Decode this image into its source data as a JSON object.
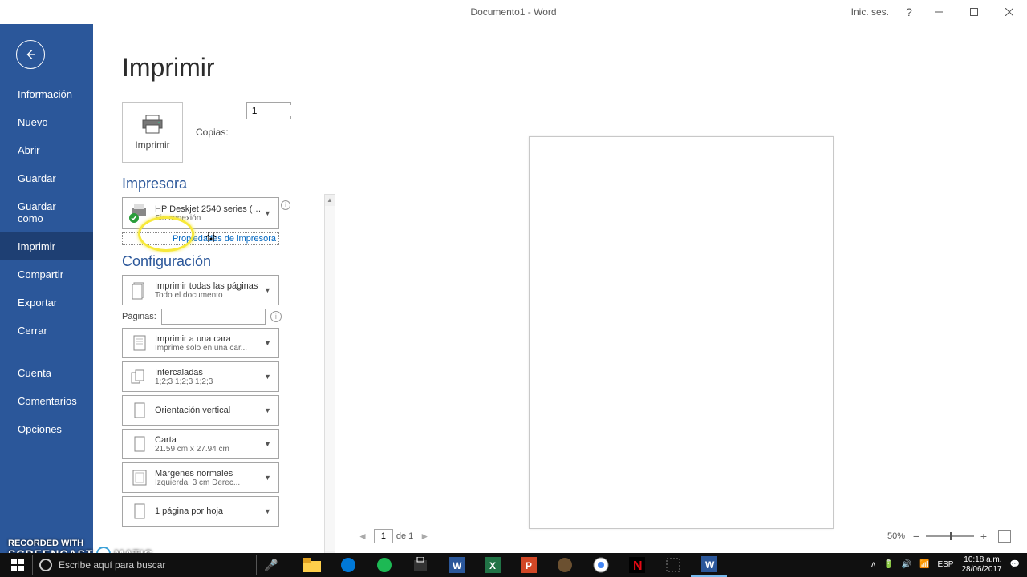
{
  "titlebar": {
    "document": "Documento1 - Word",
    "signin": "Inic. ses."
  },
  "sidebar": {
    "items": [
      "Información",
      "Nuevo",
      "Abrir",
      "Guardar",
      "Guardar como",
      "Imprimir",
      "Compartir",
      "Exportar",
      "Cerrar"
    ],
    "bottom": [
      "Cuenta",
      "Comentarios",
      "Opciones"
    ],
    "selected": "Imprimir"
  },
  "page": {
    "title": "Imprimir",
    "print_btn": "Imprimir",
    "copies_label": "Copias:",
    "copies_value": "1"
  },
  "printer": {
    "heading": "Impresora",
    "name": "HP Deskjet 2540 series (R...",
    "status": "Sin conexión",
    "properties": "Propiedades de impresora"
  },
  "config": {
    "heading": "Configuración",
    "pages_label": "Páginas:",
    "print_what": {
      "l1": "Imprimir todas las páginas",
      "l2": "Todo el documento"
    },
    "sides": {
      "l1": "Imprimir a una cara",
      "l2": "Imprime solo en una car..."
    },
    "collate": {
      "l1": "Intercaladas",
      "l2": "1;2;3    1;2;3    1;2;3"
    },
    "orient": {
      "l1": "Orientación vertical",
      "l2": ""
    },
    "paper": {
      "l1": "Carta",
      "l2": "21.59 cm x 27.94 cm"
    },
    "margins": {
      "l1": "Márgenes normales",
      "l2": "Izquierda:  3 cm    Derec..."
    },
    "ppsheet": {
      "l1": "1 página por hoja",
      "l2": ""
    }
  },
  "preview": {
    "page_current": "1",
    "page_of": "de 1",
    "zoom": "50%"
  },
  "taskbar": {
    "search_placeholder": "Escribe aquí para buscar",
    "lang": "ESP",
    "time": "10:18 a.m.",
    "date": "28/06/2017"
  },
  "watermark": {
    "l1": "RECORDED WITH",
    "l2": "SCREENCAST",
    "l3": "MATIC"
  }
}
